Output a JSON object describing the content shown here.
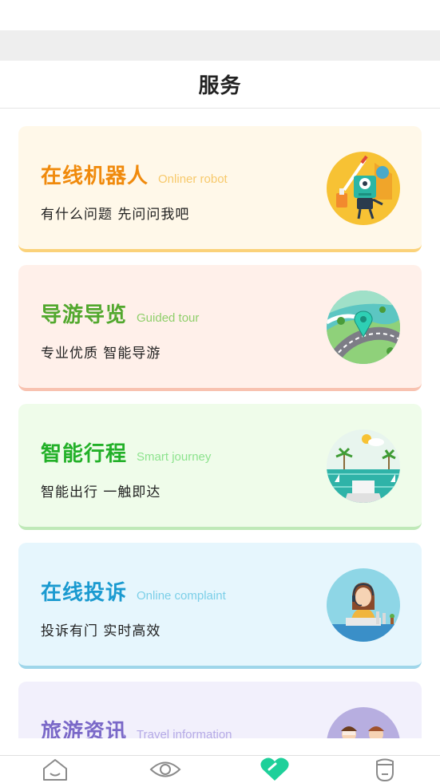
{
  "header": {
    "title": "服务"
  },
  "cards": [
    {
      "title": "在线机器人",
      "subtitle": "Onliner robot",
      "desc": "有什么问题 先问问我吧",
      "title_color": "#f08a0c",
      "subtitle_color": "#f7c96b",
      "bg": "#fff8e9",
      "border": "#fbd27a",
      "icon": "robot-icon"
    },
    {
      "title": "导游导览",
      "subtitle": "Guided tour",
      "desc": "专业优质 智能导游",
      "title_color": "#52a82e",
      "subtitle_color": "#8fcf6b",
      "bg": "#fff0ea",
      "border": "#f8c2b0",
      "icon": "map-road-icon"
    },
    {
      "title": "智能行程",
      "subtitle": "Smart journey",
      "desc": "智能出行 一触即达",
      "title_color": "#22b028",
      "subtitle_color": "#8de38e",
      "bg": "#effcea",
      "border": "#bfe9b8",
      "icon": "journey-island-icon"
    },
    {
      "title": "在线投诉",
      "subtitle": "Online complaint",
      "desc": "投诉有门 实时高效",
      "title_color": "#1a9ad0",
      "subtitle_color": "#7ccfe8",
      "bg": "#e6f6fd",
      "border": "#9fd6ea",
      "icon": "customer-service-icon"
    },
    {
      "title": "旅游资讯",
      "subtitle": "Travel information",
      "desc": "",
      "title_color": "#7a68c8",
      "subtitle_color": "#b5aae6",
      "bg": "#f2f0fc",
      "border": "#cfc7f0",
      "icon": "travel-news-icon"
    }
  ],
  "tabbar": {
    "tabs": [
      {
        "icon": "home-icon",
        "active": false
      },
      {
        "icon": "eye-icon",
        "active": false
      },
      {
        "icon": "heart-icon",
        "active": true
      },
      {
        "icon": "profile-icon",
        "active": false
      }
    ],
    "active_color": "#1ed09a",
    "inactive_color": "#8a8a8a"
  }
}
